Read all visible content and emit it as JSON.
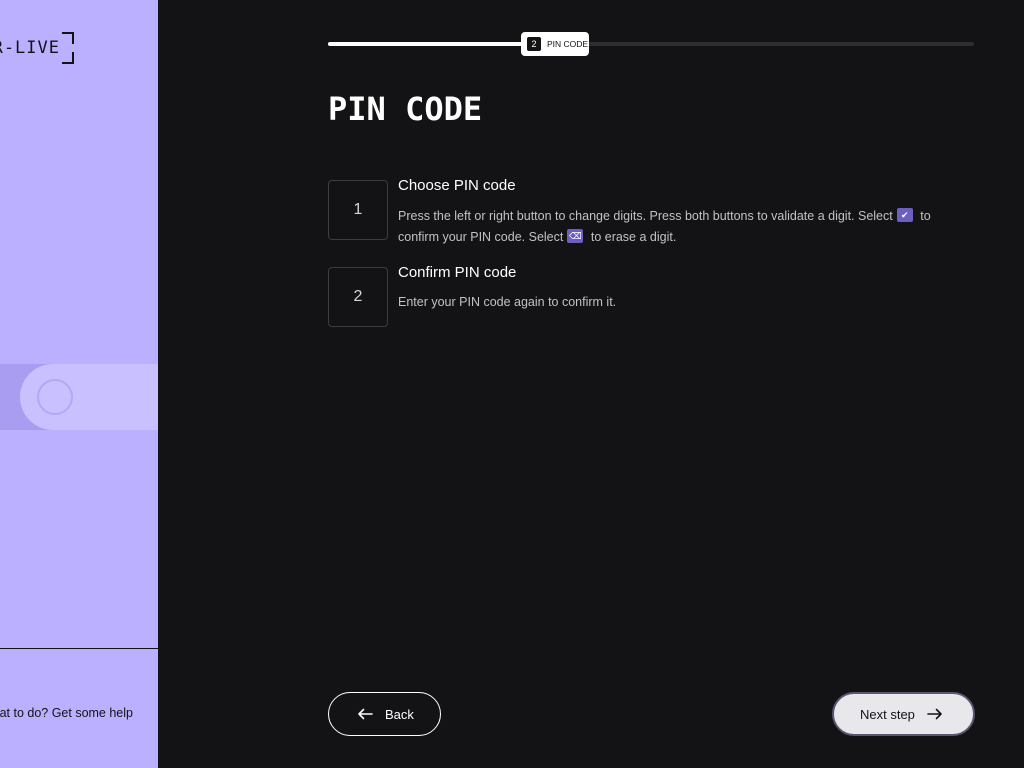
{
  "sidebar": {
    "logo_text": "LEDGER-LIVE",
    "help_text": "Not sure what to do? Get some help"
  },
  "progress": {
    "fraction": 0.3,
    "step_number": "2",
    "step_label": "PIN CODE"
  },
  "main": {
    "title": "PIN CODE",
    "steps": [
      {
        "number": "1",
        "title": "Choose PIN code",
        "desc_part1": "Press the left or right button to change digits. Press both buttons to validate a digit. Select",
        "desc_part2": "to confirm your PIN code. Select",
        "desc_part3": "to erase a digit."
      },
      {
        "number": "2",
        "title": "Confirm PIN code",
        "desc": "Enter your PIN code again to confirm it."
      }
    ]
  },
  "footer": {
    "back_label": "Back",
    "next_label": "Next step"
  },
  "colors": {
    "accent": "#bbb0ff",
    "background": "#131316"
  },
  "icons": [
    "checkmark-icon",
    "erase-icon",
    "arrow-left-icon",
    "arrow-right-icon"
  ]
}
